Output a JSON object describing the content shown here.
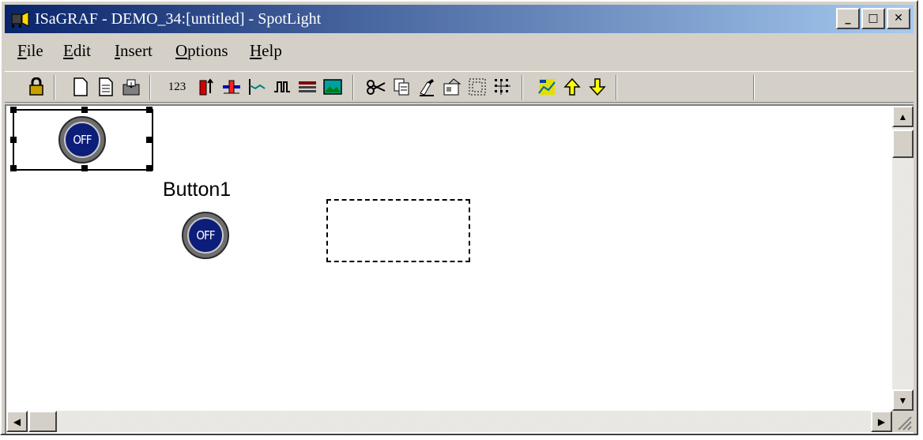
{
  "window": {
    "title": "ISaGRAF - DEMO_34:[untitled] - SpotLight",
    "controls": {
      "minimize": "_",
      "maximize": "□",
      "close": "✕"
    }
  },
  "menu": [
    {
      "label": "File"
    },
    {
      "label": "Edit"
    },
    {
      "label": "Insert"
    },
    {
      "label": "Options"
    },
    {
      "label": "Help"
    }
  ],
  "toolbar": {
    "number_tool_label": "123",
    "icons": [
      "lock-icon",
      "new-file-icon",
      "document-icon",
      "save-icon",
      "bargraph-icon",
      "slider-icon",
      "trend-icon",
      "digital-signal-icon",
      "table-icon",
      "picture-icon",
      "cut-icon",
      "copy-icon",
      "paint-icon",
      "properties-icon",
      "select-area-icon",
      "grid-icon",
      "align-icon",
      "move-up-icon",
      "move-down-icon"
    ]
  },
  "canvas": {
    "selected_object": {
      "state_label": "OFF"
    },
    "button1": {
      "label": "Button1",
      "state_label": "OFF"
    }
  },
  "colors": {
    "title_gradient_start": "#0a246a",
    "title_gradient_end": "#a6caf0",
    "button_face": "#0c1d7a"
  }
}
